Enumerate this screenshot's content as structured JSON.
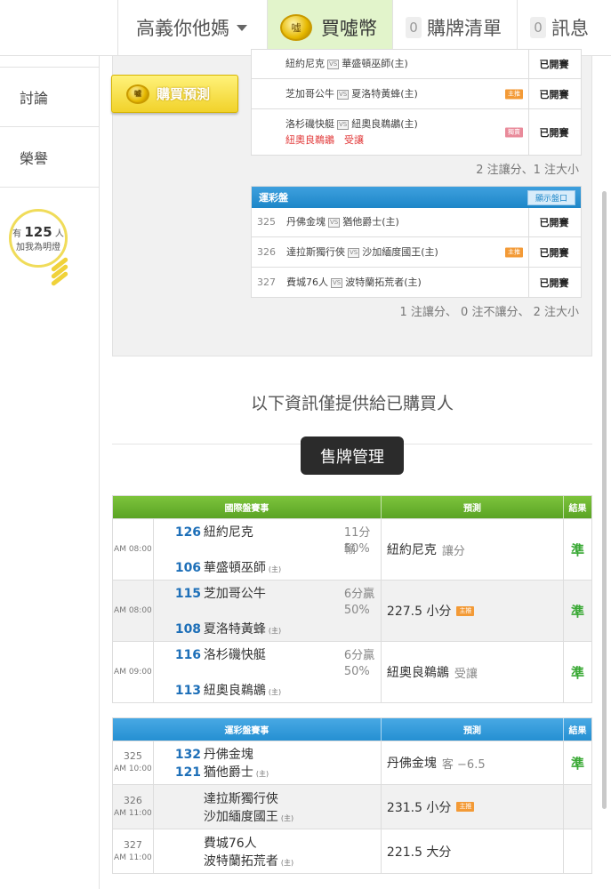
{
  "nav": {
    "user_name": "高義你他媽",
    "buy_label": "買噓幣",
    "coin_text": "噓",
    "list_count": "0",
    "list_label": "購牌清單",
    "msg_count": "0",
    "msg_label": "訊息"
  },
  "sidebar": {
    "items": [
      {
        "label": "討論"
      },
      {
        "label": "榮譽"
      }
    ],
    "fans_prefix": "有",
    "fans_count": "125",
    "fans_unit": "人",
    "fans_caption": "加我為明燈"
  },
  "buy_predict": {
    "label": "購買預測",
    "coin_text": "噓"
  },
  "intl_games": [
    {
      "text_a": "紐約尼克",
      "text_b": "華盛頓巫師(主)",
      "status": "已開賽",
      "tag": "",
      "extra": ""
    },
    {
      "text_a": "芝加哥公牛",
      "text_b": "夏洛特黃蜂(主)",
      "status": "已開賽",
      "tag": "主推",
      "extra": ""
    },
    {
      "text_a": "洛杉磯快艇",
      "text_b": "紐奧良鵜鶘(主)",
      "status": "已開賽",
      "tag": "獨賣",
      "extra": "紐奧良鵜鶘　受讓"
    }
  ],
  "intl_summary": "2 注讓分、1 注大小",
  "vs_text": "VS",
  "lotto_header": "運彩盤",
  "show_odds_btn": "顯示盤口",
  "lotto_games": [
    {
      "num": "325",
      "text_a": "丹佛金塊",
      "text_b": "猶他爵士(主)",
      "status": "已開賽",
      "tag": ""
    },
    {
      "num": "326",
      "text_a": "達拉斯獨行俠",
      "text_b": "沙加緬度國王(主)",
      "status": "已開賽",
      "tag": "主推"
    },
    {
      "num": "327",
      "text_a": "費城76人",
      "text_b": "波特蘭拓荒者(主)",
      "status": "已開賽",
      "tag": ""
    }
  ],
  "lotto_summary": "1 注讓分、 0 注不讓分、 2 注大小",
  "notice": "以下資訊僅提供給已購買人",
  "sell_btn": "售牌管理",
  "intl_table": {
    "h_game": "國際盤賽事",
    "h_pred": "預測",
    "h_res": "結果",
    "rows": [
      {
        "time": "AM 08:00",
        "n1": "126",
        "t1": "紐約尼克",
        "n2": "106",
        "t2": "華盛頓巫師",
        "home": "(主)",
        "odds1": "11分輸",
        "odds2": "50%",
        "pred": "紐約尼克",
        "pred_sub": "讓分",
        "tag": "",
        "res": "準"
      },
      {
        "time": "AM 08:00",
        "n1": "115",
        "t1": "芝加哥公牛",
        "n2": "108",
        "t2": "夏洛特黃蜂",
        "home": "(主)",
        "odds1": "6分贏",
        "odds2": "50%",
        "pred": "227.5 小分",
        "pred_sub": "",
        "tag": "主推",
        "res": "準"
      },
      {
        "time": "AM 09:00",
        "n1": "116",
        "t1": "洛杉磯快艇",
        "n2": "113",
        "t2": "紐奧良鵜鶘",
        "home": "(主)",
        "odds1": "6分贏",
        "odds2": "50%",
        "pred": "紐奧良鵜鶘",
        "pred_sub": "受讓",
        "tag": "",
        "res": "準"
      }
    ]
  },
  "lotto_table": {
    "h_game": "運彩盤賽事",
    "h_pred": "預測",
    "h_res": "結果",
    "rows": [
      {
        "num": "325",
        "time": "AM 10:00",
        "n1": "132",
        "t1": "丹佛金塊",
        "n2": "121",
        "t2": "猶他爵士",
        "home": "(主)",
        "pred": "丹佛金塊",
        "pred_sub": "客 −6.5",
        "tag": "",
        "res": "準"
      },
      {
        "num": "326",
        "time": "AM 11:00",
        "n1": "",
        "t1": "達拉斯獨行俠",
        "n2": "",
        "t2": "沙加緬度國王",
        "home": "(主)",
        "pred": "231.5 小分",
        "pred_sub": "",
        "tag": "主推",
        "res": ""
      },
      {
        "num": "327",
        "time": "AM 11:00",
        "n1": "",
        "t1": "費城76人",
        "n2": "",
        "t2": "波特蘭拓荒者",
        "home": "(主)",
        "pred": "221.5 大分",
        "pred_sub": "",
        "tag": "",
        "res": ""
      }
    ]
  }
}
